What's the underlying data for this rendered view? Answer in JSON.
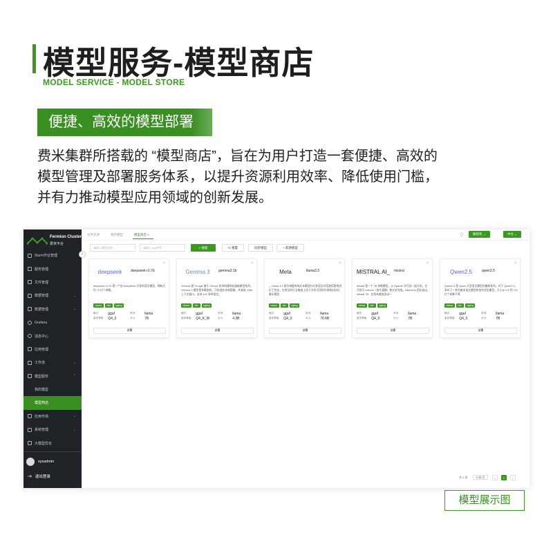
{
  "header": {
    "title": "模型服务-模型商店",
    "subtitle": "MODEL SERVICE - MODEL STORE",
    "section_badge": "便捷、高效的模型部署",
    "description_lines": [
      "费米集群所搭载的 “模型商店”，旨在为用户打造一套便捷、高效的",
      "模型管理及部署服务体系，以提升资源利用效率、降低使用门槛，",
      "并有力推动模型应用领域的创新发展。"
    ]
  },
  "app": {
    "logo": {
      "name": "Fermion Cluster",
      "sub": "费米平台"
    },
    "collapse_icon": "chevron-left-icon",
    "nav": [
      {
        "label": "Slurm作业管理",
        "icon": "doc-icon",
        "chevron": ""
      },
      {
        "label": "服务管理",
        "icon": "grid-icon",
        "chevron": ""
      },
      {
        "label": "文件管理",
        "icon": "folder-icon",
        "chevron": ""
      },
      {
        "label": "数据管理",
        "icon": "database-icon",
        "chevron": "⌄"
      },
      {
        "label": "数据管理",
        "icon": "database-icon",
        "chevron": "⌄"
      },
      {
        "label": "Grafana",
        "icon": "grafana-icon",
        "chevron": ""
      },
      {
        "label": "消息中心",
        "icon": "message-icon",
        "chevron": ""
      },
      {
        "label": "应用管理",
        "icon": "app-icon",
        "chevron": ""
      },
      {
        "label": "工作流",
        "icon": "workflow-icon",
        "chevron": "⌄"
      },
      {
        "label": "模型服务",
        "icon": "model-icon",
        "chevron": "⌃"
      },
      {
        "label": "我的模型",
        "icon": "",
        "chevron": "",
        "sub": true
      },
      {
        "label": "模型商店",
        "icon": "",
        "chevron": "",
        "sub": true,
        "active": true
      },
      {
        "label": "应用市场",
        "icon": "store-icon",
        "chevron": "⌄"
      },
      {
        "label": "系统管理",
        "icon": "settings-icon",
        "chevron": "⌄"
      },
      {
        "label": "大模型优化",
        "icon": "optimize-icon",
        "chevron": ""
      }
    ],
    "user": {
      "name": "sysadmin"
    },
    "logout_label": "退出登录",
    "breadcrumbs": [
      "文件资源",
      "我的模型",
      "模型商店 ×"
    ],
    "topbar": {
      "user_button": "秘智析 ⌄",
      "lang_button": "中文 ⌄"
    },
    "filters": {
      "name_placeholder": "请输入模型名称",
      "tag_placeholder": "请输入Tag名称",
      "search_button": "搜索",
      "reset_button": "重置",
      "sync_button": "同步模型",
      "add_button": "+ 新建模型"
    },
    "spec_keys": {
      "format": "格式:",
      "series": "系列:",
      "quant": "量化等级:",
      "size": "大小:"
    },
    "deploy_label": "部署",
    "cards": [
      {
        "logo_text": "deepseek",
        "logo_color": "#4d6bfe",
        "name": "deepseek-r1:7b",
        "desc": "deepseek-r1:7b 是一个由 DeepSeek 开发的语言模型，拥有大约 70 亿个参数。",
        "tags": [
          "ollama",
          "vllm",
          "sglang"
        ],
        "format": "gguf",
        "series": "llama",
        "quant": "Q4_0",
        "size": "7B"
      },
      {
        "logo_text": "Gemma 3",
        "logo_color": "#5b8def",
        "name": "gemma3:1b",
        "desc": "Gemma 是 Google 基于 Gemini 技术构建的轻量级模型系列。Gemma 3 模型是多模态的，可处理文本和图像。并具有 128K 上下文窗口，支持 140 多种语言。",
        "tags": [
          "ollama",
          "vllm",
          "sglang"
        ],
        "format": "gguf",
        "series": "llama",
        "quant": "Q4_K_M",
        "size": "4.3B"
      },
      {
        "logo_text": "Meta",
        "logo_color": "#1c2b33",
        "name": "llama3.3",
        "desc": "。Llama 3.3 指令调整的纯文本模型针对多语言对话使用案例进行了优化，在常见的行业基准上优于许多可用的开源和封闭式聊天模型",
        "tags": [
          "ollama",
          "vllm",
          "sglang"
        ],
        "format": "gguf",
        "series": "llama",
        "quant": "Q4_0",
        "size": "70.6B"
      },
      {
        "logo_text": "MISTRAL AI_",
        "logo_color": "#111111",
        "name": "mistral",
        "desc": "Mistral 是一个 7B 参数模型，以 Apache 许可证一起分发。它可用于 instruct（指令遵循）和文本完成。Mistral AI 团队指出，Mistral 7B：在所有基准测试一",
        "tags": [
          "ollama",
          "vllm",
          "sglang"
        ],
        "format": "gguf",
        "series": "llama",
        "quant": "Q4_0",
        "size": "7B"
      },
      {
        "logo_text": "Qwen2.5",
        "logo_color": "#615ced",
        "name": "qwen2.5",
        "desc": "Qwen2.5 是 Qwen 大型语言模型的最新系列。对于 Qwen2.5，发布了一系列基本语言模型和指令优化模型，大小从 0.5 到 720 亿个参数不等",
        "tags": [
          "ollama",
          "vllm",
          "sglang"
        ],
        "format": "gguf",
        "series": "llama",
        "quant": "Q4_0",
        "size": "7B"
      }
    ],
    "pager": {
      "total": "共 5 条",
      "page_size": "10条/页",
      "current": "1",
      "prev": "‹",
      "next": "›"
    }
  },
  "caption": "模型展示图",
  "colors": {
    "accent": "#3a9a1f",
    "sidebar_bg": "#1f2328"
  }
}
